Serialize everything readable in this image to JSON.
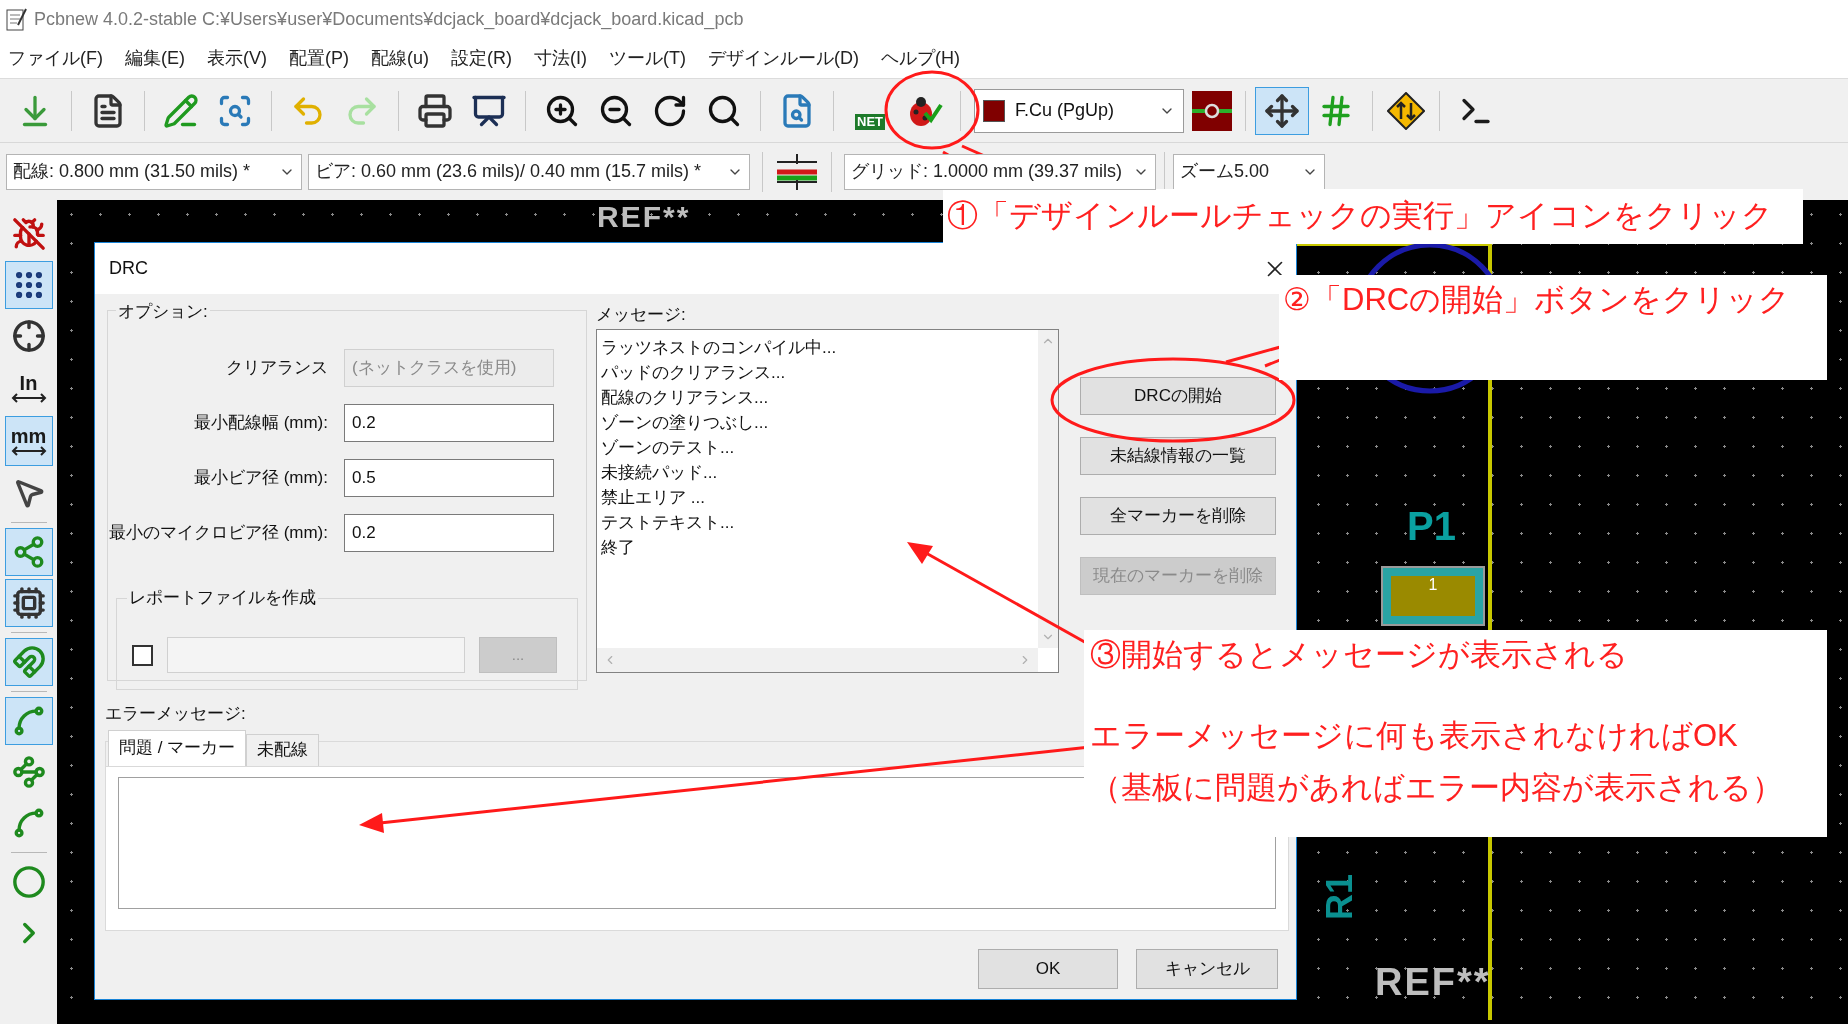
{
  "window": {
    "title": "Pcbnew 4.0.2-stable C:¥Users¥user¥Documents¥dcjack_board¥dcjack_board.kicad_pcb"
  },
  "menu": [
    "ファイル(F)",
    "編集(E)",
    "表示(V)",
    "配置(P)",
    "配線(u)",
    "設定(R)",
    "寸法(I)",
    "ツール(T)",
    "デザインルール(D)",
    "ヘルプ(H)"
  ],
  "toolbar": [
    {
      "kind": "load",
      "selected": false
    },
    {
      "kind": "sep"
    },
    {
      "kind": "page",
      "selected": false
    },
    {
      "kind": "sep"
    },
    {
      "kind": "edit_footprint",
      "selected": false
    },
    {
      "kind": "browse",
      "selected": false
    },
    {
      "kind": "sep"
    },
    {
      "kind": "undo",
      "selected": false
    },
    {
      "kind": "redo",
      "selected": false
    },
    {
      "kind": "sep"
    },
    {
      "kind": "print",
      "selected": false
    },
    {
      "kind": "plot",
      "selected": false
    },
    {
      "kind": "sep"
    },
    {
      "kind": "zoom_in",
      "selected": false
    },
    {
      "kind": "zoom_out",
      "selected": false
    },
    {
      "kind": "redraw",
      "selected": false
    },
    {
      "kind": "zoom_fit",
      "selected": false
    },
    {
      "kind": "sep"
    },
    {
      "kind": "find",
      "selected": false
    },
    {
      "kind": "sep"
    },
    {
      "kind": "netlist",
      "label": "NET",
      "selected": false
    },
    {
      "kind": "drc",
      "selected": false
    },
    {
      "kind": "sep"
    },
    {
      "kind": "layer",
      "value": "F.Cu (PgUp)",
      "color": "#800000"
    },
    {
      "kind": "layer_pair",
      "selected": false
    },
    {
      "kind": "sep"
    },
    {
      "kind": "move_grid",
      "selected": true
    },
    {
      "kind": "track_grid",
      "selected": false
    },
    {
      "kind": "sep"
    },
    {
      "kind": "autoroute",
      "selected": false
    },
    {
      "kind": "sep"
    },
    {
      "kind": "terminal",
      "selected": false
    }
  ],
  "options_bar": {
    "track": "配線: 0.800 mm (31.50 mils) *",
    "via": "ビア: 0.60 mm (23.6 mils)/ 0.40 mm (15.7 mils) *",
    "grid": "グリッド: 1.0000 mm (39.37 mils)",
    "zoom": "ズーム5.00"
  },
  "left_toolbar": [
    {
      "kind": "drc_off",
      "selected": false
    },
    {
      "kind": "grid",
      "selected": true
    },
    {
      "kind": "polar",
      "selected": false
    },
    {
      "kind": "units",
      "label": "In",
      "selected": false
    },
    {
      "kind": "units",
      "label": "mm",
      "selected": true
    },
    {
      "kind": "cursor",
      "selected": false
    },
    {
      "kind": "sep"
    },
    {
      "kind": "ratsnest",
      "selected": true
    },
    {
      "kind": "module_ratsnest",
      "selected": true
    },
    {
      "kind": "sep"
    },
    {
      "kind": "auto_delete",
      "selected": true
    },
    {
      "kind": "sep"
    },
    {
      "kind": "track_fill",
      "selected": true
    },
    {
      "kind": "track_sketch",
      "selected": false
    },
    {
      "kind": "via_sketch",
      "selected": false
    },
    {
      "kind": "sep"
    },
    {
      "kind": "circle",
      "selected": false
    },
    {
      "kind": "more",
      "selected": false
    }
  ],
  "canvas": {
    "top_ref": "REF**",
    "p1": "P1",
    "pad_number": "1",
    "r1": "R1",
    "bottom_ref": "REF**"
  },
  "dialog": {
    "title": "DRC",
    "options": {
      "label": "オプション:",
      "fields": [
        {
          "label": "クリアランス",
          "value": "(ネットクラスを使用)",
          "disabled": true
        },
        {
          "label": "最小配線幅 (mm):",
          "value": "0.2",
          "disabled": false
        },
        {
          "label": "最小ビア径 (mm):",
          "value": "0.5",
          "disabled": false
        },
        {
          "label": "最小のマイクロビア径 (mm):",
          "value": "0.2",
          "disabled": false
        }
      ],
      "report": {
        "label": "レポートファイルを作成",
        "checked": false,
        "browse": "...",
        "browse_disabled": true
      }
    },
    "messages": {
      "label": "メッセージ:",
      "lines": [
        "ラッツネストのコンパイル中...",
        "パッドのクリアランス...",
        "配線のクリアランス...",
        "ゾーンの塗りつぶし...",
        "ゾーンのテスト...",
        "未接続パッド...",
        "禁止エリア ...",
        "テストテキスト...",
        "終了"
      ]
    },
    "buttons": [
      {
        "label": "DRCの開始",
        "disabled": false
      },
      {
        "label": "未結線情報の一覧",
        "disabled": false
      },
      {
        "label": "全マーカーを削除",
        "disabled": false
      },
      {
        "label": "現在のマーカーを削除",
        "disabled": true
      }
    ],
    "errors_label": "エラーメッセージ:",
    "tabs": [
      {
        "label": "問題 / マーカー",
        "selected": true
      },
      {
        "label": "未配線",
        "selected": false
      }
    ],
    "ok": "OK",
    "cancel": "キャンセル"
  },
  "annotations": {
    "step1": "①「デザインルールチェックの実行」アイコンをクリック",
    "step2": "②「DRCの開始」ボタンをクリック",
    "step3": "③開始するとメッセージが表示される",
    "note1": "エラーメッセージに何も表示されなければOK",
    "note2": "（基板に問題があればエラー内容が表示される）"
  }
}
